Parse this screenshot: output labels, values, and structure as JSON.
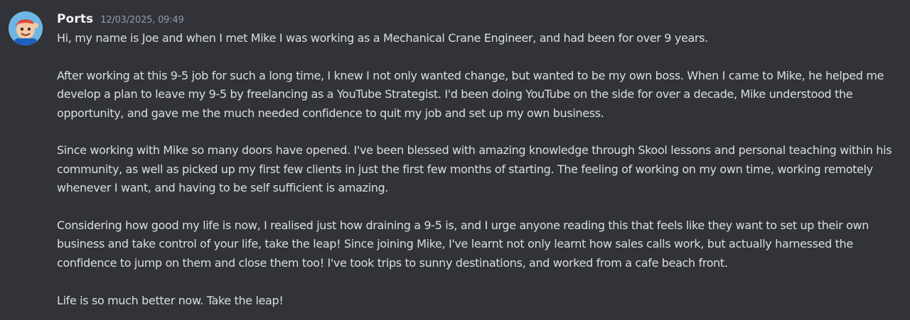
{
  "author": {
    "name": "Ports",
    "timestamp": "12/03/2025, 09:49"
  },
  "paragraphs": [
    "Hi, my name is Joe and when I met Mike I was working as a Mechanical Crane Engineer, and had been for over 9 years.",
    "After working at this 9-5 job for such a long time, I knew I not only wanted change, but wanted to be my own boss. When I came to Mike, he helped me develop a plan to leave my 9-5 by freelancing as a YouTube Strategist. I'd been doing YouTube on the side for over a decade, Mike understood the opportunity, and gave me the much needed confidence to quit my job and set up my own business.",
    "Since working with Mike so many doors have opened. I've been blessed with amazing knowledge through Skool lessons and personal teaching within his community, as well as picked up my first few clients in just the first few months of starting. The feeling of working on my own time, working remotely whenever I want, and having to be self sufficient is amazing.",
    "Considering how good my life is now, I realised just how draining a 9-5 is, and I urge anyone reading this that feels like they want to set up their own business and take control of your life, take the leap! Since joining Mike, I've learnt not only learnt how sales calls work, but actually harnessed the confidence to jump on them and close them too! I've took trips to sunny destinations, and worked from a cafe beach front.",
    "Life is so much better now. Take the leap!"
  ],
  "colors": {
    "background": "#313338",
    "username": "#f2f3f5",
    "timestamp": "#949ba4",
    "text": "#dbdee1"
  }
}
